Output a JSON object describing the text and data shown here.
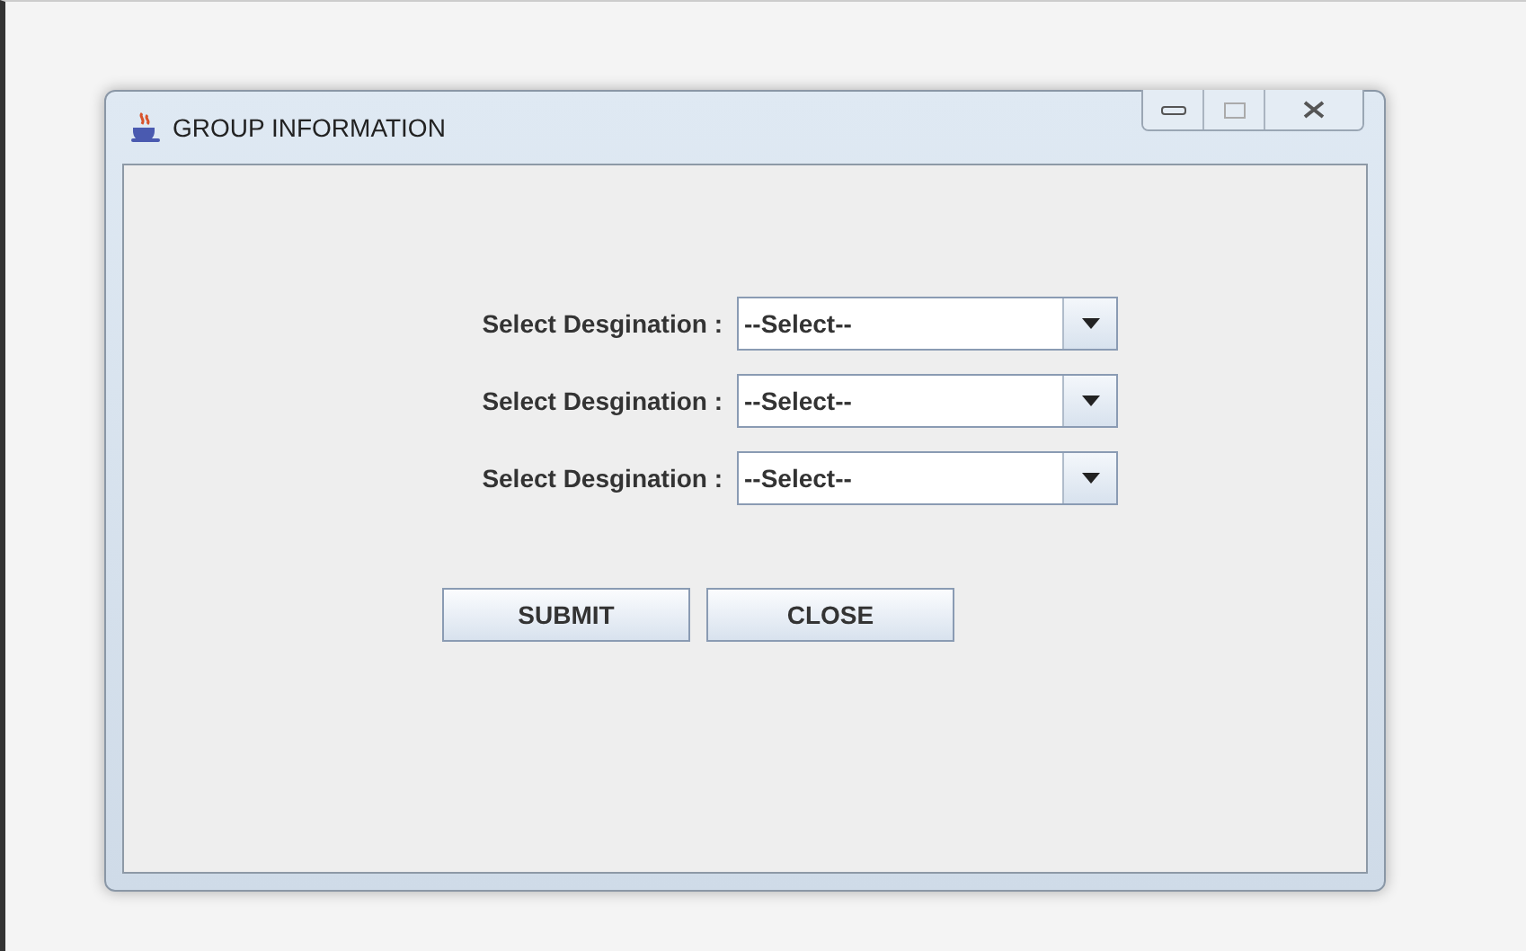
{
  "window": {
    "title": "GROUP INFORMATION"
  },
  "fields": [
    {
      "label": "Select Desgination :",
      "value": "--Select--"
    },
    {
      "label": "Select Desgination :",
      "value": "--Select--"
    },
    {
      "label": "Select Desgination :",
      "value": "--Select--"
    }
  ],
  "buttons": [
    "SUBMIT",
    "CLOSE"
  ]
}
